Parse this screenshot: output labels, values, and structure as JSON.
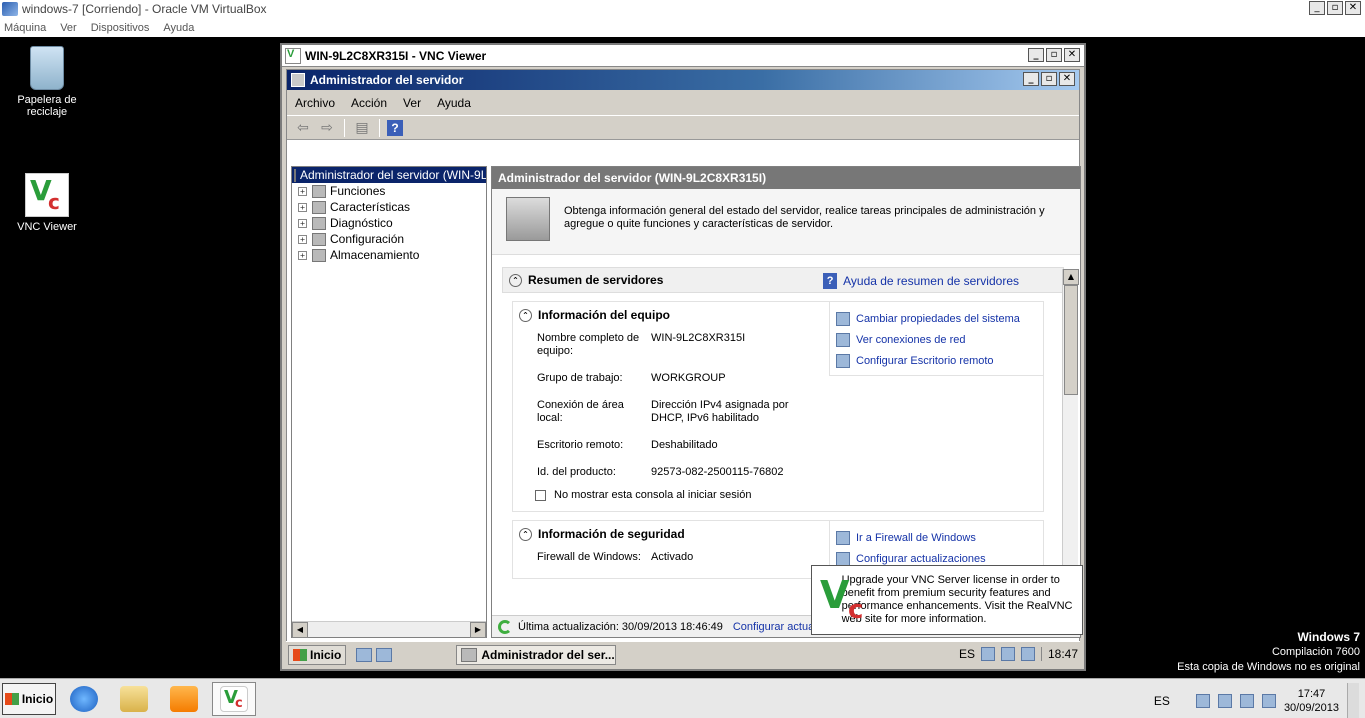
{
  "vbox": {
    "title": "windows-7 [Corriendo] - Oracle VM VirtualBox",
    "menu": [
      "Máquina",
      "Ver",
      "Dispositivos",
      "Ayuda"
    ],
    "controls": [
      "_",
      "▫",
      "✕"
    ]
  },
  "desktop": {
    "recycle_label": "Papelera de reciclaje",
    "vnc_label": "VNC Viewer"
  },
  "vnc_window": {
    "title": "WIN-9L2C8XR315I - VNC Viewer"
  },
  "server_manager": {
    "title": "Administrador del servidor",
    "menu": [
      "Archivo",
      "Acción",
      "Ver",
      "Ayuda"
    ],
    "tree": {
      "root": "Administrador del servidor (WIN-9L",
      "items": [
        "Funciones",
        "Características",
        "Diagnóstico",
        "Configuración",
        "Almacenamiento"
      ]
    },
    "content_header": "Administrador del servidor (WIN-9L2C8XR315I)",
    "intro_text": "Obtenga información general del estado del servidor, realice tareas principales de administración y agregue o quite funciones y características de servidor.",
    "summary": {
      "title": "Resumen de servidores",
      "help_link": "Ayuda de resumen de servidores"
    },
    "computer_info": {
      "title": "Información del equipo",
      "props": [
        {
          "k": "Nombre completo de equipo:",
          "v": "WIN-9L2C8XR315I"
        },
        {
          "k": "Grupo de trabajo:",
          "v": "WORKGROUP"
        },
        {
          "k": "Conexión de área local:",
          "v": "Dirección IPv4 asignada por DHCP, IPv6 habilitado"
        },
        {
          "k": "Escritorio remoto:",
          "v": "Deshabilitado"
        },
        {
          "k": "Id. del producto:",
          "v": "92573-082-2500115-76802"
        }
      ],
      "tasks": [
        "Cambiar propiedades del sistema",
        "Ver conexiones de red",
        "Configurar Escritorio remoto"
      ],
      "checkbox_label": "No mostrar esta consola al iniciar sesión"
    },
    "security_info": {
      "title": "Información de seguridad",
      "props": [
        {
          "k": "Firewall de Windows:",
          "v": "Activado"
        }
      ],
      "tasks": [
        "Ir a Firewall de Windows",
        "Configurar actualizaciones"
      ]
    },
    "status": {
      "last_update": "Última actualización: 30/09/2013 18:46:49",
      "configure_link": "Configurar actualización"
    }
  },
  "inner_taskbar": {
    "start": "Inicio",
    "task": "Administrador del ser...",
    "lang": "ES",
    "time": "18:47"
  },
  "vnc_popup": {
    "message": "Upgrade your VNC Server license in order to benefit from premium security features and performance enhancements. Visit the RealVNC web site for more information."
  },
  "watermark": {
    "line1": "Windows 7",
    "line2": "Compilación  7600",
    "line3": "Esta copia de Windows no es original"
  },
  "outer_taskbar": {
    "start": "Inicio",
    "lang": "ES",
    "time": "17:47",
    "date": "30/09/2013"
  }
}
